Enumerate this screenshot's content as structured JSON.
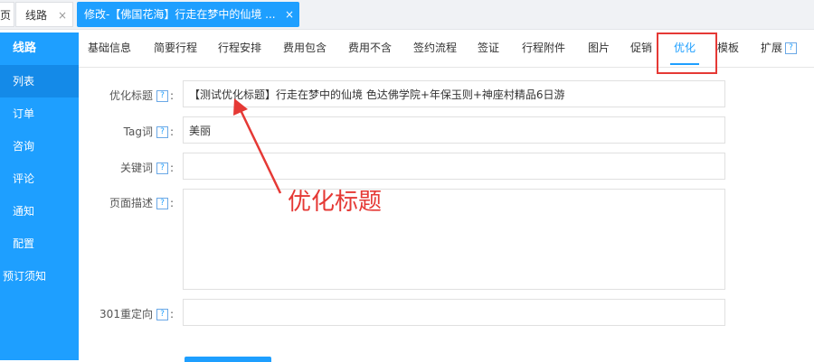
{
  "top_tabs": {
    "home": "页",
    "route": "线路",
    "active": "修改-【佛国花海】行走在梦中的仙境 ...",
    "close": "×"
  },
  "sidebar": {
    "items": [
      {
        "label": "线路"
      },
      {
        "label": "列表"
      },
      {
        "label": "订单"
      },
      {
        "label": "咨询"
      },
      {
        "label": "评论"
      },
      {
        "label": "通知"
      },
      {
        "label": "配置"
      },
      {
        "label": "预订须知"
      }
    ]
  },
  "sub_tabs": [
    {
      "label": "基础信息"
    },
    {
      "label": "简要行程"
    },
    {
      "label": "行程安排"
    },
    {
      "label": "费用包含"
    },
    {
      "label": "费用不含"
    },
    {
      "label": "签约流程"
    },
    {
      "label": "签证"
    },
    {
      "label": "行程附件"
    },
    {
      "label": "图片"
    },
    {
      "label": "促销"
    },
    {
      "label": "优化"
    },
    {
      "label": "模板"
    },
    {
      "label": "扩展"
    }
  ],
  "help_mark": "?",
  "colon": ":",
  "form": {
    "seo_title": {
      "label": "优化标题",
      "value": "【测试优化标题】行走在梦中的仙境 色达佛学院+年保玉则+神座村精品6日游"
    },
    "tag": {
      "label": "Tag词",
      "value": "美丽"
    },
    "keywords": {
      "label": "关键词",
      "value": ""
    },
    "description": {
      "label": "页面描述",
      "value": ""
    },
    "redirect": {
      "label": "301重定向",
      "value": ""
    }
  },
  "annotation": "优化标题",
  "colors": {
    "primary": "#1e9fff",
    "annotation": "#e53935"
  }
}
